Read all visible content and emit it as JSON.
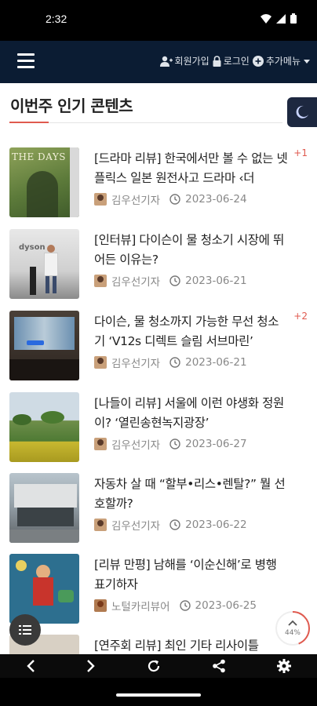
{
  "status": {
    "time": "2:32"
  },
  "nav": {
    "signup": "회원가입",
    "login": "로그인",
    "more_menu": "추가메뉴"
  },
  "section": {
    "title": "이번주 인기 콘텐츠"
  },
  "articles": [
    {
      "title": "[드라마 리뷰] 한국에서만 볼 수 없는 넷플릭스 일본 원전사고 드라마 ‹더",
      "author": "김우선기자",
      "date": "2023-06-24",
      "rank_change": "+1",
      "thumb_text": "THE DAYS"
    },
    {
      "title": "[인터뷰] 다이슨이 물 청소기 시장에 뛰어든 이유는?",
      "author": "김우선기자",
      "date": "2023-06-21",
      "rank_change": "",
      "thumb_text": "dyson"
    },
    {
      "title": "다이슨, 물 청소까지 가능한 무선 청소기 ‘V12s 디렉트 슬림 서브마린’",
      "author": "김우선기자",
      "date": "2023-06-21",
      "rank_change": "+2",
      "thumb_text": ""
    },
    {
      "title": "[나들이 리뷰] 서울에 이런 야생화 정원이? ‘열린송현녹지광장’",
      "author": "김우선기자",
      "date": "2023-06-27",
      "rank_change": "",
      "thumb_text": ""
    },
    {
      "title": "자동차 살 때 “할부•리스•렌탈?” 뭘 선호할까?",
      "author": "김우선기자",
      "date": "2023-06-22",
      "rank_change": "",
      "thumb_text": ""
    },
    {
      "title": "[리뷰 만평] 남해를 ‘이순신해’로 병행 표기하자",
      "author": "노털카리뷰어",
      "date": "2023-06-25",
      "rank_change": "",
      "thumb_text": ""
    },
    {
      "title": "[연주회 리뷰] 최인 기타 리사이틀",
      "author": "",
      "date": "",
      "rank_change": "",
      "thumb_text": ""
    }
  ],
  "scroll_progress": {
    "label": "44%",
    "value": 44
  },
  "colors": {
    "nav_bg": "#0b1c33",
    "accent": "#e05a4f",
    "toggle_bg": "#1d2840"
  },
  "icons": {
    "signup": "user-plus-icon",
    "login": "lock-icon",
    "more": "plus-circle-icon",
    "back": "chevron-left-icon",
    "forward": "chevron-right-icon",
    "refresh": "refresh-icon",
    "share": "share-icon",
    "settings": "gear-icon",
    "theme": "moon-icon"
  }
}
